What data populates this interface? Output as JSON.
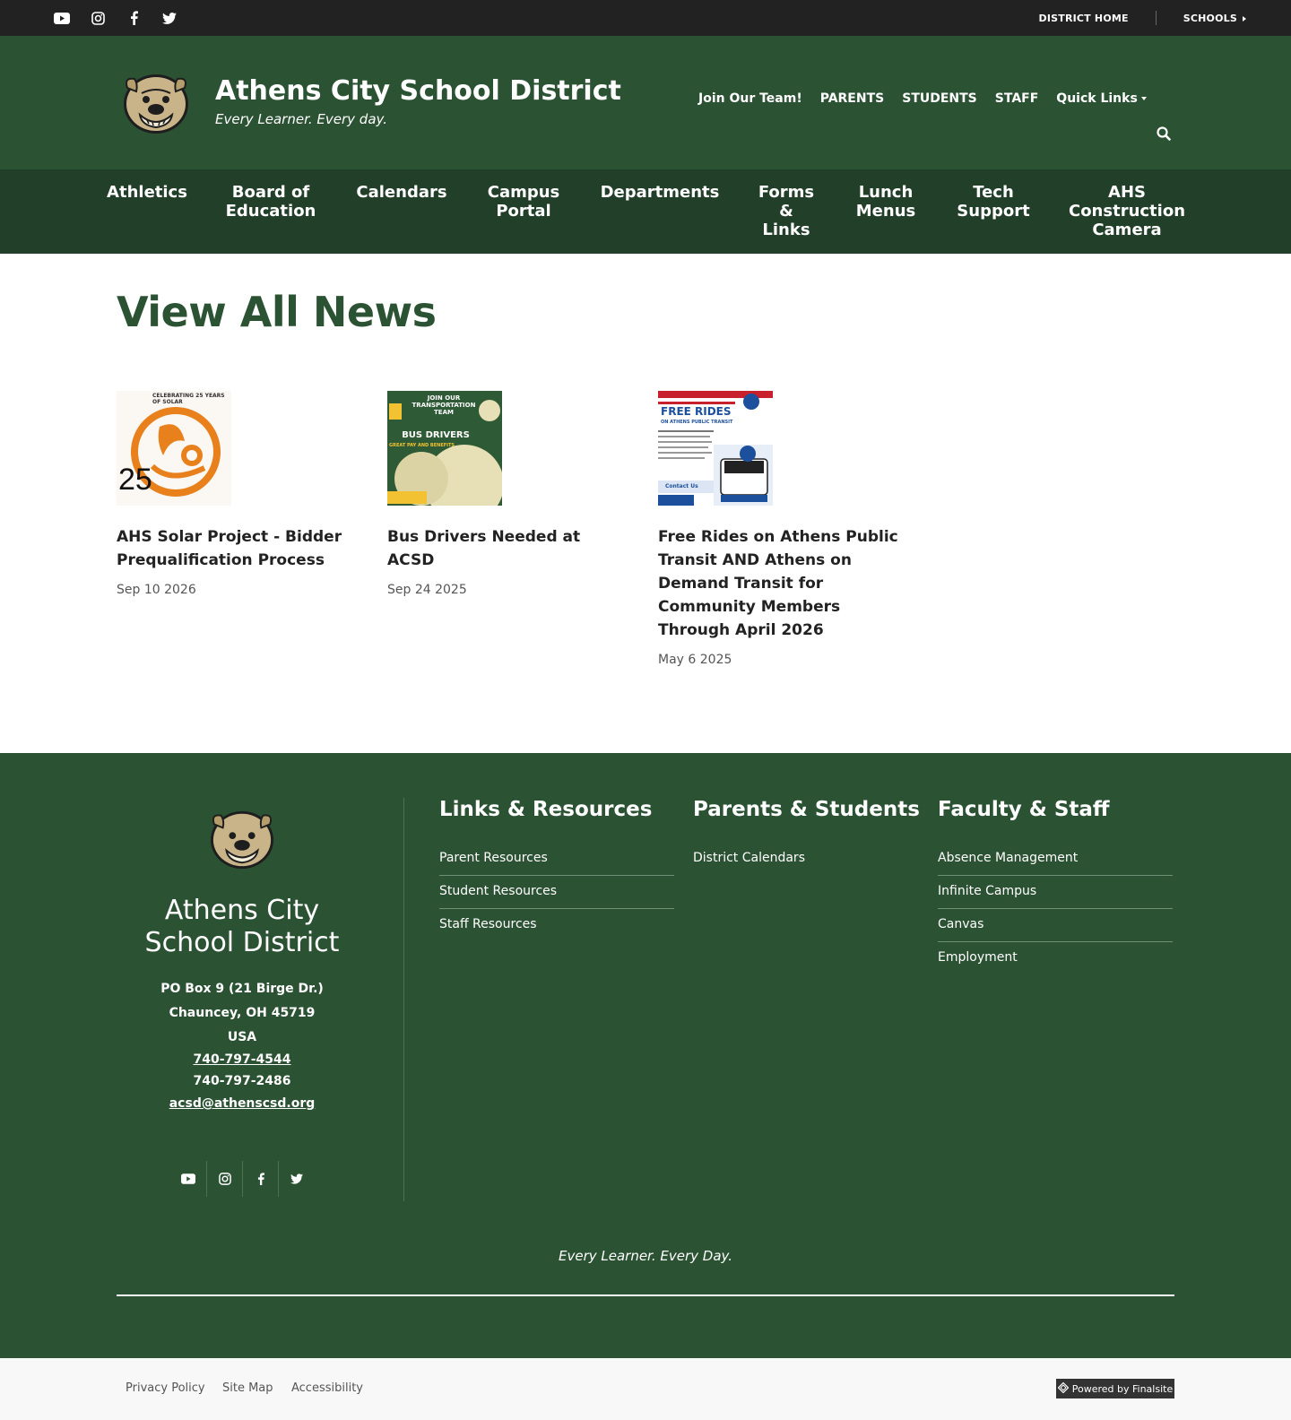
{
  "topbar": {
    "social_icons": [
      "youtube-icon",
      "instagram-icon",
      "facebook-icon",
      "twitter-icon"
    ],
    "district_home": "DISTRICT HOME",
    "schools": "SCHOOLS"
  },
  "header": {
    "title": "Athens City School District",
    "tagline": "Every Learner. Every day.",
    "nav": [
      "Join Our Team!",
      "PARENTS",
      "STUDENTS",
      "STAFF",
      "Quick Links"
    ]
  },
  "main_nav": [
    "Athletics",
    "Board of\nEducation",
    "Calendars",
    "Campus\nPortal",
    "Departments",
    "Forms\n&\nLinks",
    "Lunch\nMenus",
    "Tech\nSupport",
    "AHS\nConstruction\nCamera"
  ],
  "page": {
    "title": "View All News"
  },
  "news": [
    {
      "title": "AHS Solar Project - Bidder Prequalification Process",
      "date": "Sep 10 2026",
      "thumb_text": "CELEBRATING 25 YEARS OF SOLAR",
      "thumb_number": "25"
    },
    {
      "title": "Bus Drivers Needed at ACSD",
      "date": "Sep 24 2025",
      "thumb_text": "JOIN OUR TRANSPORTATION TEAM",
      "thumb_sub": "BUS DRIVERS",
      "thumb_small": "GREAT PAY AND BENEFITS"
    },
    {
      "title": "Free Rides on Athens Public Transit AND Athens on Demand Transit for Community Members Through April 2026",
      "date": "May 6 2025",
      "thumb_text": "FREE RIDES",
      "thumb_sub": "ON ATHENS PUBLIC TRANSIT",
      "thumb_small": "Contact Us"
    }
  ],
  "footer": {
    "name": "Athens City School District",
    "address_line1": "PO Box 9 (21 Birge Dr.)",
    "address_line2": "Chauncey, OH  45719",
    "address_line3": "USA",
    "phone": "740-797-4544",
    "fax": "740-797-2486",
    "email": "acsd@athenscsd.org",
    "columns": [
      {
        "heading": "Links & Resources",
        "links": [
          "Parent Resources",
          "Student Resources",
          "Staff Resources"
        ]
      },
      {
        "heading": "Parents & Students",
        "links": [
          "District Calendars"
        ]
      },
      {
        "heading": "Faculty & Staff",
        "links": [
          "Absence Management",
          "Infinite Campus",
          "Canvas",
          "Employment"
        ]
      }
    ],
    "motto": "Every Learner.  Every Day."
  },
  "bottom": {
    "links": [
      "Privacy Policy",
      "Site Map",
      "Accessibility"
    ],
    "powered": "Powered by Finalsite"
  },
  "colors": {
    "brand_green": "#2c5234",
    "nav_green": "#223f29",
    "topbar": "#222222"
  }
}
